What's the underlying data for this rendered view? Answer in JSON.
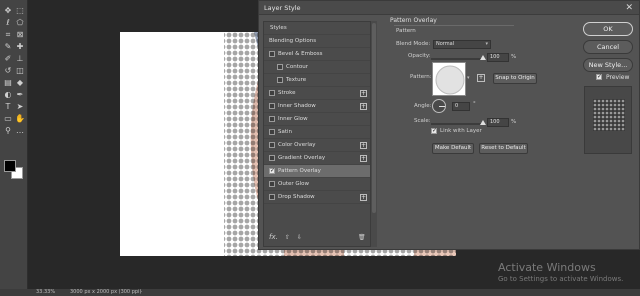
{
  "toolbar": {
    "tools": [
      {
        "name": "move-tool-icon",
        "glyph": "✥"
      },
      {
        "name": "marquee-tool-icon",
        "glyph": "⬚"
      },
      {
        "name": "lasso-tool-icon",
        "glyph": "ℓ"
      },
      {
        "name": "quick-select-icon",
        "glyph": "⬠"
      },
      {
        "name": "crop-tool-icon",
        "glyph": "⌗"
      },
      {
        "name": "frame-tool-icon",
        "glyph": "⊠"
      },
      {
        "name": "eyedropper-icon",
        "glyph": "✎"
      },
      {
        "name": "healing-brush-icon",
        "glyph": "✚"
      },
      {
        "name": "brush-tool-icon",
        "glyph": "✐"
      },
      {
        "name": "stamp-tool-icon",
        "glyph": "⊥"
      },
      {
        "name": "history-brush-icon",
        "glyph": "↺"
      },
      {
        "name": "eraser-tool-icon",
        "glyph": "◫"
      },
      {
        "name": "gradient-tool-icon",
        "glyph": "▤"
      },
      {
        "name": "blur-tool-icon",
        "glyph": "◆"
      },
      {
        "name": "dodge-tool-icon",
        "glyph": "◐"
      },
      {
        "name": "pen-tool-icon",
        "glyph": "✒"
      },
      {
        "name": "type-tool-icon",
        "glyph": "T"
      },
      {
        "name": "path-select-icon",
        "glyph": "➤"
      },
      {
        "name": "shape-tool-icon",
        "glyph": "▭"
      },
      {
        "name": "hand-tool-icon",
        "glyph": "✋"
      },
      {
        "name": "zoom-tool-icon",
        "glyph": "⚲"
      },
      {
        "name": "more-tools-icon",
        "glyph": "…"
      }
    ],
    "foreground_color": "#000000",
    "background_color": "#ffffff"
  },
  "status": {
    "zoom": "33.33%",
    "doc_info": "3000 px x 2000 px (300 ppi)",
    "arrow": "›"
  },
  "watermark": {
    "line1": "Activate Windows",
    "line2": "Go to Settings to activate Windows."
  },
  "dialog": {
    "title": "Layer Style",
    "close_glyph": "✕",
    "styles_header": "Styles",
    "items": [
      {
        "label": "Blending Options",
        "checkbox": false,
        "checked": false,
        "plus": false,
        "indent": 0,
        "selected": false
      },
      {
        "label": "Bevel & Emboss",
        "checkbox": true,
        "checked": false,
        "plus": false,
        "indent": 0,
        "selected": false
      },
      {
        "label": "Contour",
        "checkbox": true,
        "checked": false,
        "plus": false,
        "indent": 1,
        "selected": false
      },
      {
        "label": "Texture",
        "checkbox": true,
        "checked": false,
        "plus": false,
        "indent": 1,
        "selected": false
      },
      {
        "label": "Stroke",
        "checkbox": true,
        "checked": false,
        "plus": true,
        "indent": 0,
        "selected": false
      },
      {
        "label": "Inner Shadow",
        "checkbox": true,
        "checked": false,
        "plus": true,
        "indent": 0,
        "selected": false
      },
      {
        "label": "Inner Glow",
        "checkbox": true,
        "checked": false,
        "plus": false,
        "indent": 0,
        "selected": false
      },
      {
        "label": "Satin",
        "checkbox": true,
        "checked": false,
        "plus": false,
        "indent": 0,
        "selected": false
      },
      {
        "label": "Color Overlay",
        "checkbox": true,
        "checked": false,
        "plus": true,
        "indent": 0,
        "selected": false
      },
      {
        "label": "Gradient Overlay",
        "checkbox": true,
        "checked": false,
        "plus": true,
        "indent": 0,
        "selected": false
      },
      {
        "label": "Pattern Overlay",
        "checkbox": true,
        "checked": true,
        "plus": false,
        "indent": 0,
        "selected": true
      },
      {
        "label": "Outer Glow",
        "checkbox": true,
        "checked": false,
        "plus": false,
        "indent": 0,
        "selected": false
      },
      {
        "label": "Drop Shadow",
        "checkbox": true,
        "checked": false,
        "plus": true,
        "indent": 0,
        "selected": false
      }
    ],
    "footer": {
      "fx": "fx.",
      "up": "⇧",
      "down": "⇩",
      "trash": "🗑"
    },
    "pattern_overlay": {
      "section": "Pattern Overlay",
      "subsection": "Pattern",
      "blend_mode_label": "Blend Mode:",
      "blend_mode_value": "Normal",
      "opacity_label": "Opacity:",
      "opacity_value": "100",
      "opacity_level": 1.0,
      "pattern_label": "Pattern:",
      "snap_button": "Snap to Origin",
      "angle_label": "Angle:",
      "angle_value": "0",
      "angle_unit": "°",
      "scale_label": "Scale:",
      "scale_value": "100",
      "scale_level": 1.0,
      "pct": "%",
      "link_label": "Link with Layer",
      "make_default": "Make Default",
      "reset_default": "Reset to Default"
    },
    "buttons": {
      "ok": "OK",
      "cancel": "Cancel",
      "new_style": "New Style...",
      "preview": "Preview"
    }
  }
}
